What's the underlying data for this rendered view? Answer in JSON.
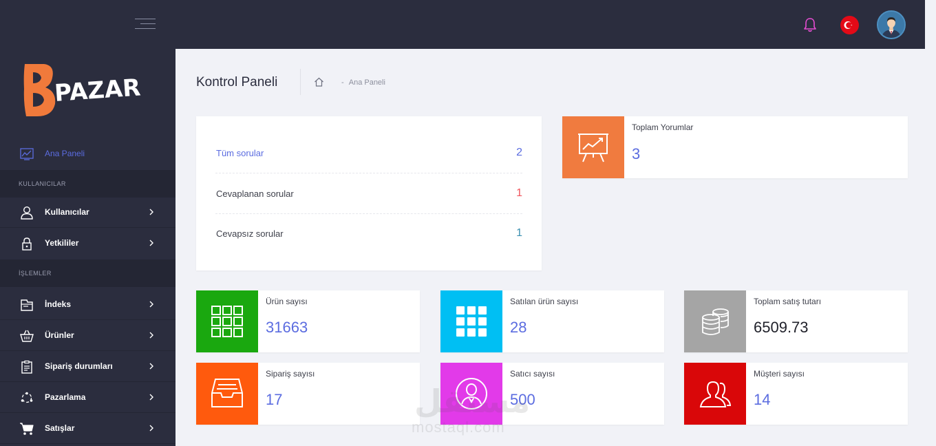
{
  "brand": {
    "logo_text": "BPAZAR"
  },
  "header": {
    "language": "Türkçe"
  },
  "sidebar": {
    "active_item": {
      "label": "Ana Paneli",
      "icon": "chart-line-icon"
    },
    "sections": [
      {
        "title": "KULLANICILAR",
        "items": [
          {
            "label": "Kullanıcılar",
            "icon": "user-icon"
          },
          {
            "label": "Yetkililer",
            "icon": "lock-icon"
          }
        ]
      },
      {
        "title": "İŞLEMLER",
        "items": [
          {
            "label": "İndeks",
            "icon": "folder-icon"
          },
          {
            "label": "Ürünler",
            "icon": "basket-icon"
          },
          {
            "label": "Sipariş durumları",
            "icon": "clipboard-icon"
          },
          {
            "label": "Pazarlama",
            "icon": "network-icon"
          },
          {
            "label": "Satışlar",
            "icon": "cart-icon"
          }
        ]
      }
    ]
  },
  "page": {
    "title": "Kontrol Paneli",
    "breadcrumb": {
      "separator": "-",
      "current": "Ana Paneli"
    }
  },
  "questions": [
    {
      "label": "Tüm sorular",
      "value": "2",
      "label_color": "#5b6ce0",
      "value_color": "#5b6ce0"
    },
    {
      "label": "Cevaplanan sorular",
      "value": "1",
      "label_color": "#3d3f4a",
      "value_color": "#f0535b"
    },
    {
      "label": "Cevapsız sorular",
      "value": "1",
      "label_color": "#3d3f4a",
      "value_color": "#3a8fb0"
    }
  ],
  "reviews": {
    "label": "Toplam Yorumlar",
    "value": "3",
    "color": "#f07b3f"
  },
  "stats": [
    {
      "label": "Ürün sayısı",
      "value": "31663",
      "color": "#1aa80f",
      "icon": "grid-outline-icon"
    },
    {
      "label": "Satılan ürün sayısı",
      "value": "28",
      "color": "#00bff3",
      "icon": "grid-solid-icon"
    },
    {
      "label": "Toplam satış tutarı",
      "value": "6509.73",
      "color": "#a5a5a5",
      "icon": "coins-icon"
    },
    {
      "label": "Sipariş sayısı",
      "value": "17",
      "color": "#ff5a0d",
      "icon": "inbox-icon"
    },
    {
      "label": "Satıcı sayısı",
      "value": "500",
      "color": "#e23ae9",
      "icon": "seller-icon"
    },
    {
      "label": "Müşteri sayısı",
      "value": "14",
      "color": "#d90709",
      "icon": "users-icon"
    }
  ],
  "watermark": {
    "arabic": "مستقل",
    "latin": "mostaql.com"
  }
}
